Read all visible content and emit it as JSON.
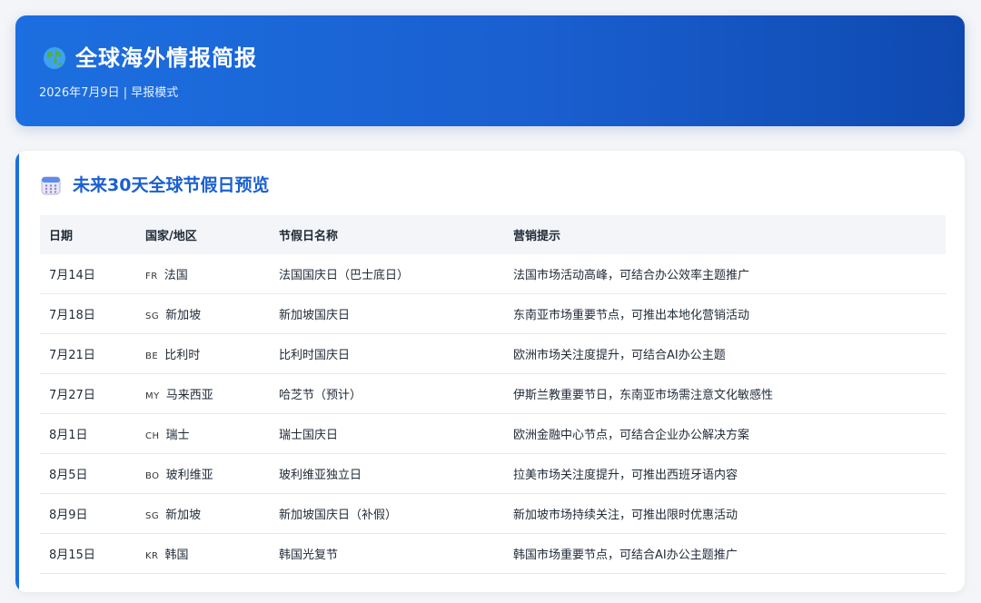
{
  "header": {
    "icon": "globe-icon",
    "title": "全球海外情报简报",
    "subtitle": "2026年7月9日 | 早报模式",
    "gradient": [
      "#1c6fe0",
      "#0f49b0"
    ]
  },
  "holidays": {
    "icon": "calendar-icon",
    "title": "未来30天全球节假日预览",
    "accent": "#1c6fe0",
    "columns": [
      "日期",
      "国家/地区",
      "节假日名称",
      "营销提示"
    ],
    "rows": [
      {
        "date": "7月14日",
        "code": "FR",
        "country": "法国",
        "name": "法国国庆日（巴士底日）",
        "tip": "法国市场活动高峰，可结合办公效率主题推广"
      },
      {
        "date": "7月18日",
        "code": "SG",
        "country": "新加坡",
        "name": "新加坡国庆日",
        "tip": "东南亚市场重要节点，可推出本地化营销活动"
      },
      {
        "date": "7月21日",
        "code": "BE",
        "country": "比利时",
        "name": "比利时国庆日",
        "tip": "欧洲市场关注度提升，可结合AI办公主题"
      },
      {
        "date": "7月27日",
        "code": "MY",
        "country": "马来西亚",
        "name": "哈芝节（预计）",
        "tip": "伊斯兰教重要节日，东南亚市场需注意文化敏感性"
      },
      {
        "date": "8月1日",
        "code": "CH",
        "country": "瑞士",
        "name": "瑞士国庆日",
        "tip": "欧洲金融中心节点，可结合企业办公解决方案"
      },
      {
        "date": "8月5日",
        "code": "BO",
        "country": "玻利维亚",
        "name": "玻利维亚独立日",
        "tip": "拉美市场关注度提升，可推出西班牙语内容"
      },
      {
        "date": "8月9日",
        "code": "SG",
        "country": "新加坡",
        "name": "新加坡国庆日（补假）",
        "tip": "新加坡市场持续关注，可推出限时优惠活动"
      },
      {
        "date": "8月15日",
        "code": "KR",
        "country": "韩国",
        "name": "韩国光复节",
        "tip": "韩国市场重要节点，可结合AI办公主题推广"
      }
    ]
  }
}
